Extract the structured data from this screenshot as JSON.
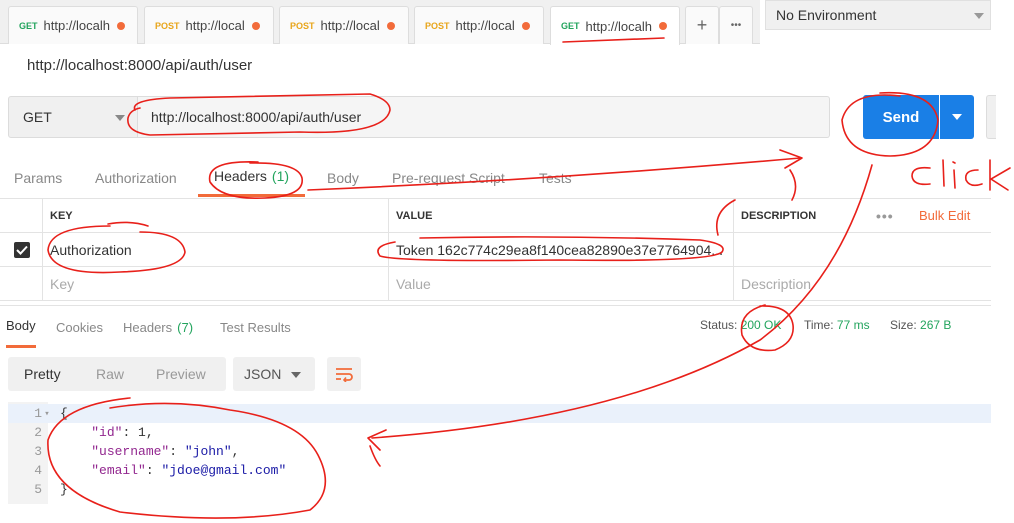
{
  "tabs": [
    {
      "method": "GET",
      "url": "http://localh"
    },
    {
      "method": "POST",
      "url": "http://local"
    },
    {
      "method": "POST",
      "url": "http://local"
    },
    {
      "method": "POST",
      "url": "http://local"
    },
    {
      "method": "GET",
      "url": "http://localh"
    }
  ],
  "tab_actions": {
    "add": "+",
    "more": "•••"
  },
  "environment": {
    "selected": "No Environment"
  },
  "request": {
    "title": "http://localhost:8000/api/auth/user",
    "method": "GET",
    "url": "http://localhost:8000/api/auth/user",
    "send_label": "Send"
  },
  "request_tabs": [
    {
      "label": "Params"
    },
    {
      "label": "Authorization"
    },
    {
      "label": "Headers",
      "count": "(1)"
    },
    {
      "label": "Body"
    },
    {
      "label": "Pre-request Script"
    },
    {
      "label": "Tests"
    }
  ],
  "headers_table": {
    "columns": {
      "key": "KEY",
      "value": "VALUE",
      "description": "DESCRIPTION"
    },
    "more": "•••",
    "bulk_edit": "Bulk Edit",
    "rows": [
      {
        "key": "Authorization",
        "value": "Token 162c774c29ea8f140cea82890e37e7764904...",
        "checked": true
      }
    ],
    "placeholders": {
      "key": "Key",
      "value": "Value",
      "description": "Description"
    }
  },
  "response_tabs": [
    {
      "label": "Body"
    },
    {
      "label": "Cookies"
    },
    {
      "label": "Headers",
      "count": "(7)"
    },
    {
      "label": "Test Results"
    }
  ],
  "response_meta": {
    "status_label": "Status:",
    "status": "200 OK",
    "time_label": "Time:",
    "time": "77 ms",
    "size_label": "Size:",
    "size": "267 B"
  },
  "body_view": {
    "modes": [
      "Pretty",
      "Raw",
      "Preview"
    ],
    "format": "JSON"
  },
  "code_lines": [
    {
      "n": "1",
      "text": "{"
    },
    {
      "n": "2",
      "key": "\"id\"",
      "sep": ": ",
      "val": "1",
      "end": ","
    },
    {
      "n": "3",
      "key": "\"username\"",
      "sep": ": ",
      "val": "\"john\"",
      "end": ","
    },
    {
      "n": "4",
      "key": "\"email\"",
      "sep": ": ",
      "val": "\"jdoe@gmail.com\"",
      "end": ""
    },
    {
      "n": "5",
      "text": "}"
    }
  ],
  "annotation": {
    "handwritten_text": "Click",
    "color": "#e8201a"
  },
  "colors": {
    "accent": "#f26b3a",
    "send": "#1a7fe6",
    "ok": "#22a45d",
    "get": "#22a45d",
    "post": "#e8a51a"
  }
}
